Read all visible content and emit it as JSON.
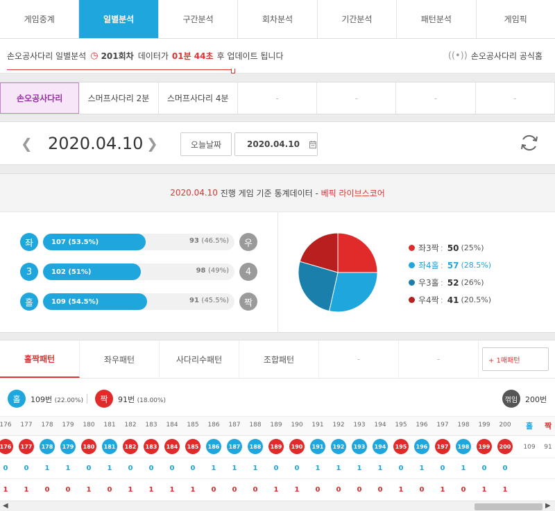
{
  "nav": {
    "tabs": [
      {
        "label": "게임중계",
        "active": false
      },
      {
        "label": "일별분석",
        "active": true
      },
      {
        "label": "구간분석",
        "active": false
      },
      {
        "label": "회차분석",
        "active": false
      },
      {
        "label": "기간분석",
        "active": false
      },
      {
        "label": "패턴분석",
        "active": false
      },
      {
        "label": "게임픽",
        "active": false
      }
    ]
  },
  "info": {
    "prefix": "손오공사다리 일별분석",
    "round": "201회차",
    "mid": "데이터가",
    "countdown": "01분 44초",
    "suffix": "후 업데이트 됩니다",
    "official_link": "손오공사다리 공식홈"
  },
  "games": [
    "손오공사다리",
    "스머프사다리 2분",
    "스머프사다리 4분",
    "-",
    "-",
    "-",
    "-"
  ],
  "date": {
    "current": "2020.04.10",
    "today_label": "오늘날짜",
    "picker_value": "2020.04.10"
  },
  "stats": {
    "title_date": "2020.04.10",
    "title_mid": "진행 게임 기준 통계데이터 -",
    "title_brand": "베픽 라이브스코어",
    "bars": [
      {
        "left": "좌",
        "right": "우",
        "left_text": "107 (53.5%)",
        "right_count": "93",
        "right_pct": "(46.5%)",
        "fraction": 0.535
      },
      {
        "left": "3",
        "right": "4",
        "left_text": "102 (51%)",
        "right_count": "98",
        "right_pct": "(49%)",
        "fraction": 0.51
      },
      {
        "left": "홀",
        "right": "짝",
        "left_text": "109 (54.5%)",
        "right_count": "91",
        "right_pct": "(45.5%)",
        "fraction": 0.545
      }
    ],
    "pie": [
      {
        "label": "좌3짝",
        "value": "50",
        "pct": "(25%)",
        "share": 25,
        "color": "#e12a2a",
        "highlight": false
      },
      {
        "label": "좌4홀",
        "value": "57",
        "pct": "(28.5%)",
        "share": 28.5,
        "color": "#1fa6dc",
        "highlight": true
      },
      {
        "label": "우3홀",
        "value": "52",
        "pct": "(26%)",
        "share": 26,
        "color": "#1a80ab",
        "highlight": false
      },
      {
        "label": "우4짝",
        "value": "41",
        "pct": "(20.5%)",
        "share": 20.5,
        "color": "#b81f1f",
        "highlight": false
      }
    ]
  },
  "pattern": {
    "tabs": [
      {
        "label": "홀짝패턴",
        "active": true
      },
      {
        "label": "좌우패턴",
        "active": false
      },
      {
        "label": "사다리수패턴",
        "active": false
      },
      {
        "label": "조합패턴",
        "active": false
      },
      {
        "label": "-",
        "active": false
      },
      {
        "label": "-",
        "active": false
      }
    ],
    "extra_button": "+ 1매패턴",
    "summary": {
      "odd_label": "홀",
      "odd_text": "109번",
      "odd_pct": "(22.00%)",
      "even_label": "짝",
      "even_text": "91번",
      "even_pct": "(18.00%)",
      "break_label": "꺾임",
      "break_text": "200번"
    },
    "rounds": [
      "176",
      "177",
      "178",
      "179",
      "180",
      "181",
      "182",
      "183",
      "184",
      "185",
      "186",
      "187",
      "188",
      "189",
      "190",
      "191",
      "192",
      "193",
      "194",
      "195",
      "196",
      "197",
      "198",
      "199",
      "200"
    ],
    "results": [
      "even",
      "even",
      "odd",
      "odd",
      "even",
      "odd",
      "even",
      "even",
      "even",
      "even",
      "odd",
      "odd",
      "odd",
      "even",
      "even",
      "odd",
      "odd",
      "odd",
      "odd",
      "even",
      "odd",
      "even",
      "odd",
      "even",
      "even"
    ],
    "odd_row": [
      "0",
      "0",
      "1",
      "1",
      "0",
      "1",
      "0",
      "0",
      "0",
      "0",
      "1",
      "1",
      "1",
      "0",
      "0",
      "1",
      "1",
      "1",
      "1",
      "0",
      "1",
      "0",
      "1",
      "0",
      "0"
    ],
    "even_row": [
      "1",
      "1",
      "0",
      "0",
      "1",
      "0",
      "1",
      "1",
      "1",
      "1",
      "0",
      "0",
      "0",
      "1",
      "1",
      "0",
      "0",
      "0",
      "0",
      "1",
      "0",
      "1",
      "0",
      "1",
      "1"
    ],
    "total_odd_label": "홀",
    "total_even_label": "짝",
    "total_odd": "109",
    "total_even": "91"
  }
}
